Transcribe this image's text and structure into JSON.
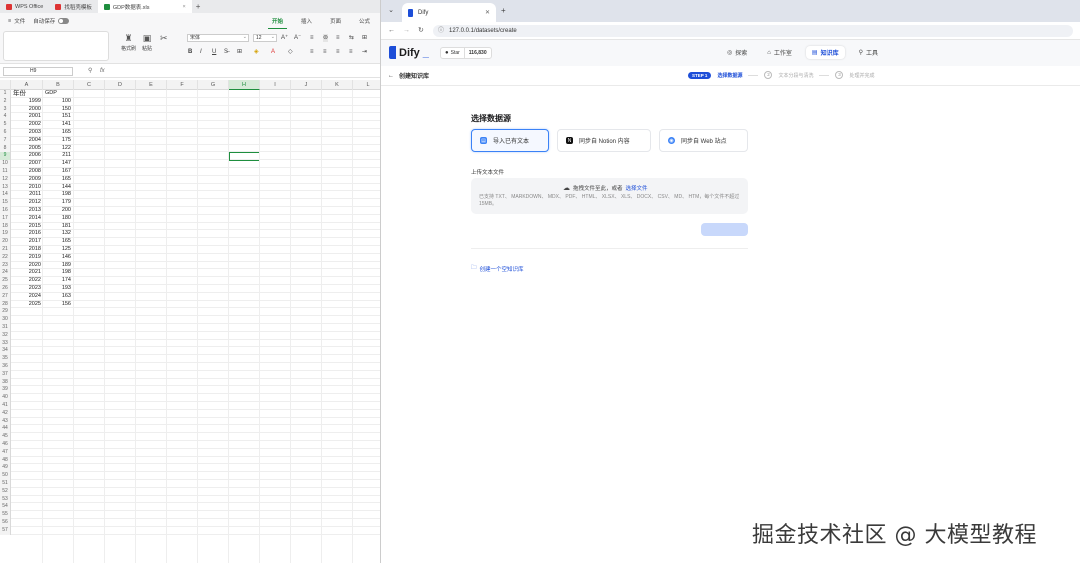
{
  "wps": {
    "tabs": [
      {
        "label": "WPS Office",
        "color": "#d33"
      },
      {
        "label": "找稻壳模板",
        "color": "#d33"
      },
      {
        "label": "GDP数据表.xls",
        "color": "#1e8e3e"
      }
    ],
    "menu": {
      "file": "文件",
      "autosave": "自动保存",
      "tabs": [
        "开始",
        "插入",
        "页面",
        "公式"
      ]
    },
    "ribbon": {
      "format_painter": "格式刷",
      "paste": "粘贴",
      "font_name": "宋体",
      "font_size": "12",
      "bold": "B",
      "italic": "I",
      "underline": "U"
    },
    "namebox": "H9",
    "fx_label": "fx",
    "columns": [
      "A",
      "B",
      "C",
      "D",
      "E",
      "F",
      "G",
      "H",
      "I",
      "J",
      "K",
      "L"
    ],
    "selected_col": "H",
    "selected_row": 9,
    "header_row": {
      "year": "年份",
      "gdp": "GDP"
    },
    "rows": [
      {
        "year": "1999",
        "gdp": "100"
      },
      {
        "year": "2000",
        "gdp": "150"
      },
      {
        "year": "2001",
        "gdp": "151"
      },
      {
        "year": "2002",
        "gdp": "141"
      },
      {
        "year": "2003",
        "gdp": "165"
      },
      {
        "year": "2004",
        "gdp": "175"
      },
      {
        "year": "2005",
        "gdp": "122"
      },
      {
        "year": "2006",
        "gdp": "211"
      },
      {
        "year": "2007",
        "gdp": "147"
      },
      {
        "year": "2008",
        "gdp": "167"
      },
      {
        "year": "2009",
        "gdp": "165"
      },
      {
        "year": "2010",
        "gdp": "144"
      },
      {
        "year": "2011",
        "gdp": "198"
      },
      {
        "year": "2012",
        "gdp": "179"
      },
      {
        "year": "2013",
        "gdp": "200"
      },
      {
        "year": "2014",
        "gdp": "180"
      },
      {
        "year": "2015",
        "gdp": "181"
      },
      {
        "year": "2016",
        "gdp": "132"
      },
      {
        "year": "2017",
        "gdp": "165"
      },
      {
        "year": "2018",
        "gdp": "125"
      },
      {
        "year": "2019",
        "gdp": "146"
      },
      {
        "year": "2020",
        "gdp": "189"
      },
      {
        "year": "2021",
        "gdp": "198"
      },
      {
        "year": "2022",
        "gdp": "174"
      },
      {
        "year": "2023",
        "gdp": "193"
      },
      {
        "year": "2024",
        "gdp": "163"
      },
      {
        "year": "2025",
        "gdp": "156"
      }
    ],
    "total_rows": 57
  },
  "browser": {
    "tab_title": "Dify",
    "url": "127.0.0.1/datasets/create"
  },
  "dify": {
    "logo": "Dify",
    "github": {
      "label": "Star",
      "count": "116,830"
    },
    "nav": [
      {
        "label": "探索",
        "icon": "◎",
        "active": false
      },
      {
        "label": "工作室",
        "icon": "⌂",
        "active": false
      },
      {
        "label": "知识库",
        "icon": "▤",
        "active": true
      },
      {
        "label": "工具",
        "icon": "⚲",
        "active": false
      }
    ],
    "back_label": "创建知识库",
    "steps": {
      "badge": "STEP 1",
      "active": "选择数据源",
      "step2_num": "2",
      "step2": "文本分段与清洗",
      "step3_num": "3",
      "step3": "处理并完成"
    },
    "section_title": "选择数据源",
    "sources": [
      {
        "label": "导入已有文本",
        "icon": "▤",
        "color": "#3b82f6",
        "active": true
      },
      {
        "label": "同步自 Notion 内容",
        "icon": "N",
        "color": "#111",
        "active": false
      },
      {
        "label": "同步自 Web 站点",
        "icon": "◉",
        "color": "#3b82f6",
        "active": false
      }
    ],
    "upload_label": "上传文本文件",
    "drop_text": "拖拽文件至此，或者",
    "drop_link": "选择文件",
    "drop_hint": "已支持 TXT、 MARKDOWN、 MDX、 PDF、 HTML、 XLSX、 XLS、 DOCX、 CSV、 MD、 HTM，每个文件不超过 15MB。",
    "create_empty": "创建一个空知识库"
  },
  "watermark": "掘金技术社区 @ 大模型教程"
}
